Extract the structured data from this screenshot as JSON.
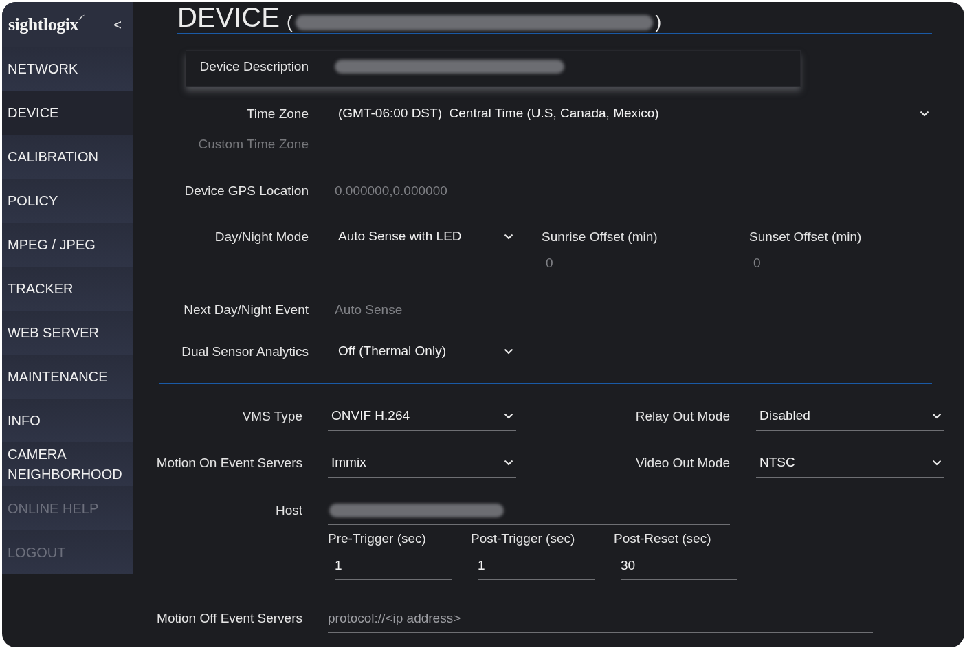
{
  "sidebar": {
    "logo": "sightlogix",
    "collapse_button": "<",
    "items": [
      {
        "label": "NETWORK",
        "selected": false,
        "disabled": false
      },
      {
        "label": "DEVICE",
        "selected": true,
        "disabled": false
      },
      {
        "label": "CALIBRATION",
        "selected": false,
        "disabled": false
      },
      {
        "label": "POLICY",
        "selected": false,
        "disabled": false
      },
      {
        "label": "MPEG / JPEG",
        "selected": false,
        "disabled": false
      },
      {
        "label": "TRACKER",
        "selected": false,
        "disabled": false
      },
      {
        "label": "WEB SERVER",
        "selected": false,
        "disabled": false
      },
      {
        "label": "MAINTENANCE",
        "selected": false,
        "disabled": false
      },
      {
        "label": "INFO",
        "selected": false,
        "disabled": false
      },
      {
        "label": "CAMERA NEIGHBORHOOD",
        "selected": false,
        "disabled": false
      },
      {
        "label": "ONLINE HELP",
        "selected": false,
        "disabled": true
      },
      {
        "label": "LOGOUT",
        "selected": false,
        "disabled": true
      }
    ]
  },
  "header": {
    "title": "DEVICE",
    "open_bracket": "(",
    "id_blurred": true,
    "close_bracket": ")"
  },
  "device_description": {
    "label": "Device Description",
    "value_blurred": true
  },
  "settings": [
    {
      "kind": "wide_select",
      "label": "Time Zone",
      "value": "(GMT-06:00 DST)  Central Time (U.S, Canada, Mexico)"
    },
    {
      "kind": "label",
      "label": "Custom Time Zone",
      "disabled": true
    },
    {
      "kind": "text",
      "label": "Device GPS Location",
      "value": "0.000000,0.000000"
    },
    {
      "kind": "select_offsets",
      "label": "Day/Night Mode",
      "value": "Auto Sense with LED",
      "offsets": [
        {
          "label": "Sunrise Offset (min)",
          "value": "0"
        },
        {
          "label": "Sunset Offset (min)",
          "value": "0"
        }
      ]
    },
    {
      "kind": "text",
      "label": "Next Day/Night Event",
      "value": "Auto Sense"
    },
    {
      "kind": "select",
      "label": "Dual Sensor Analytics",
      "value": "Off (Thermal Only)"
    }
  ],
  "event_settings": [
    {
      "kind": "pair",
      "label": "VMS Type",
      "value": "ONVIF H.264",
      "right_label": "Relay Out Mode",
      "right_value": "Disabled"
    },
    {
      "kind": "pair",
      "label": "Motion On Event Servers",
      "value": "Immix",
      "right_label": "Video Out Mode",
      "right_value": "NTSC"
    },
    {
      "kind": "input",
      "label": "Host",
      "value_blurred": true
    },
    {
      "kind": "triggers",
      "fields": [
        {
          "label": "Pre-Trigger (sec)",
          "value": "1"
        },
        {
          "label": "Post-Trigger (sec)",
          "value": "1"
        },
        {
          "label": "Post-Reset (sec)",
          "value": "30"
        }
      ]
    },
    {
      "kind": "long_input",
      "label": "Motion Off Event Servers",
      "placeholder": "protocol://<ip address>"
    }
  ]
}
